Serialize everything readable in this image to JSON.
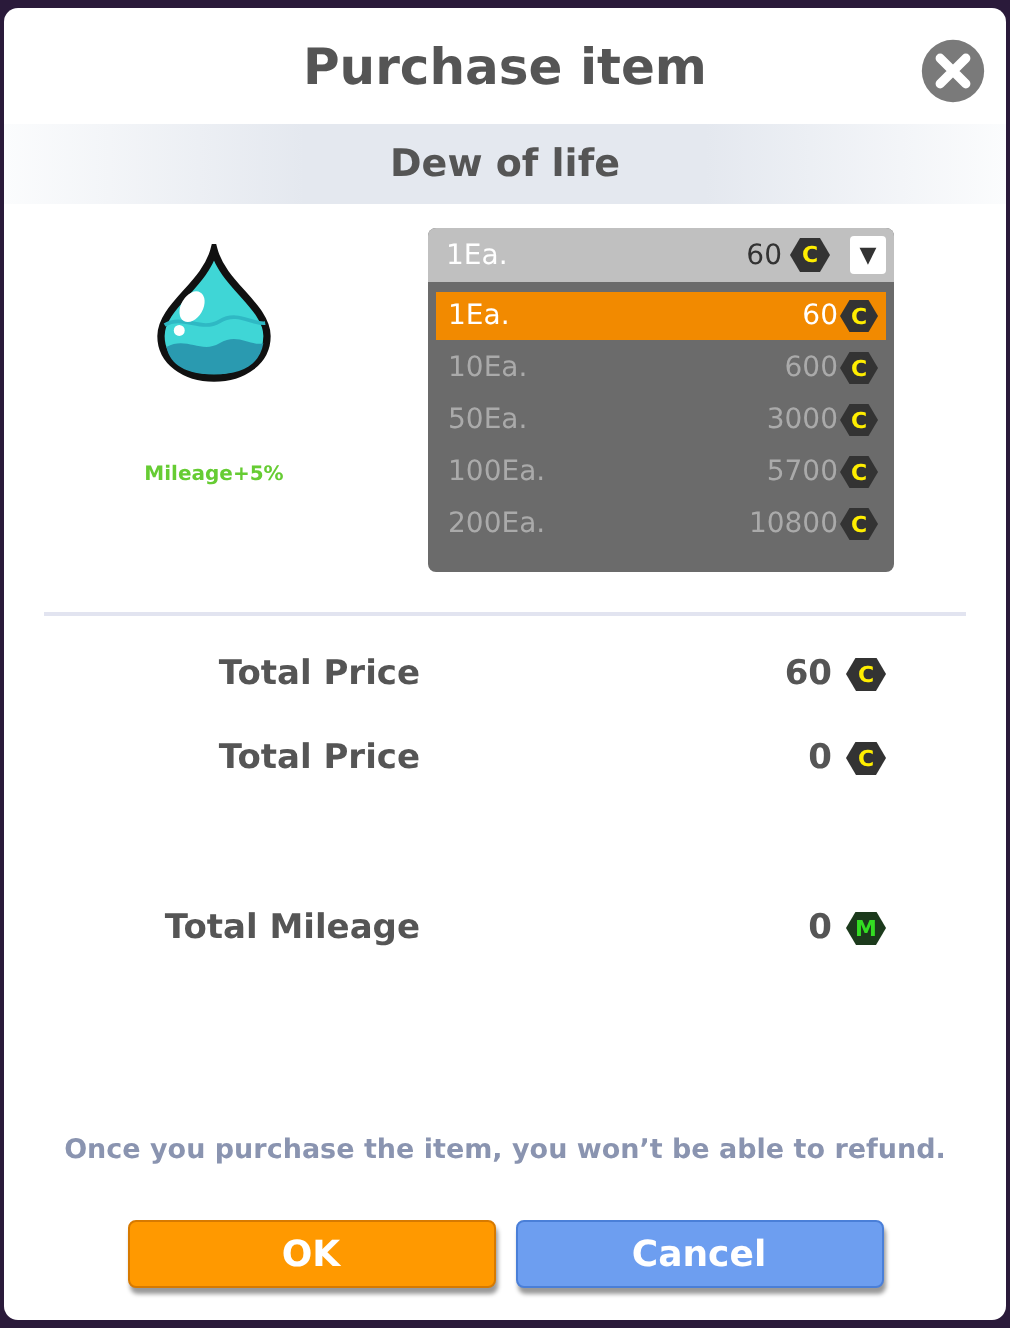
{
  "dialog": {
    "title": "Purchase item",
    "item_name": "Dew of life",
    "bonus": "Mileage+5%"
  },
  "dropdown": {
    "current": {
      "quantity": "1Ea.",
      "price": "60",
      "currency": "C"
    },
    "arrow": "▼",
    "options": [
      {
        "quantity": "1Ea.",
        "price": "60",
        "currency": "C",
        "selected": true
      },
      {
        "quantity": "10Ea.",
        "price": "600",
        "currency": "C",
        "selected": false
      },
      {
        "quantity": "50Ea.",
        "price": "3000",
        "currency": "C",
        "selected": false
      },
      {
        "quantity": "100Ea.",
        "price": "5700",
        "currency": "C",
        "selected": false
      },
      {
        "quantity": "200Ea.",
        "price": "10800",
        "currency": "C",
        "selected": false
      }
    ]
  },
  "totals": [
    {
      "label": "Total Price",
      "value": "60",
      "currency": "C",
      "kind": "coin"
    },
    {
      "label": "Total Price",
      "value": "0",
      "currency": "C",
      "kind": "coin"
    },
    {
      "label": "Total Mileage",
      "value": "0",
      "currency": "M",
      "kind": "mileage"
    }
  ],
  "notice": "Once you purchase the item, you won’t be able to refund.",
  "buttons": [
    {
      "label": "OK",
      "kind": "primary"
    },
    {
      "label": "Cancel",
      "kind": "secondary"
    }
  ]
}
